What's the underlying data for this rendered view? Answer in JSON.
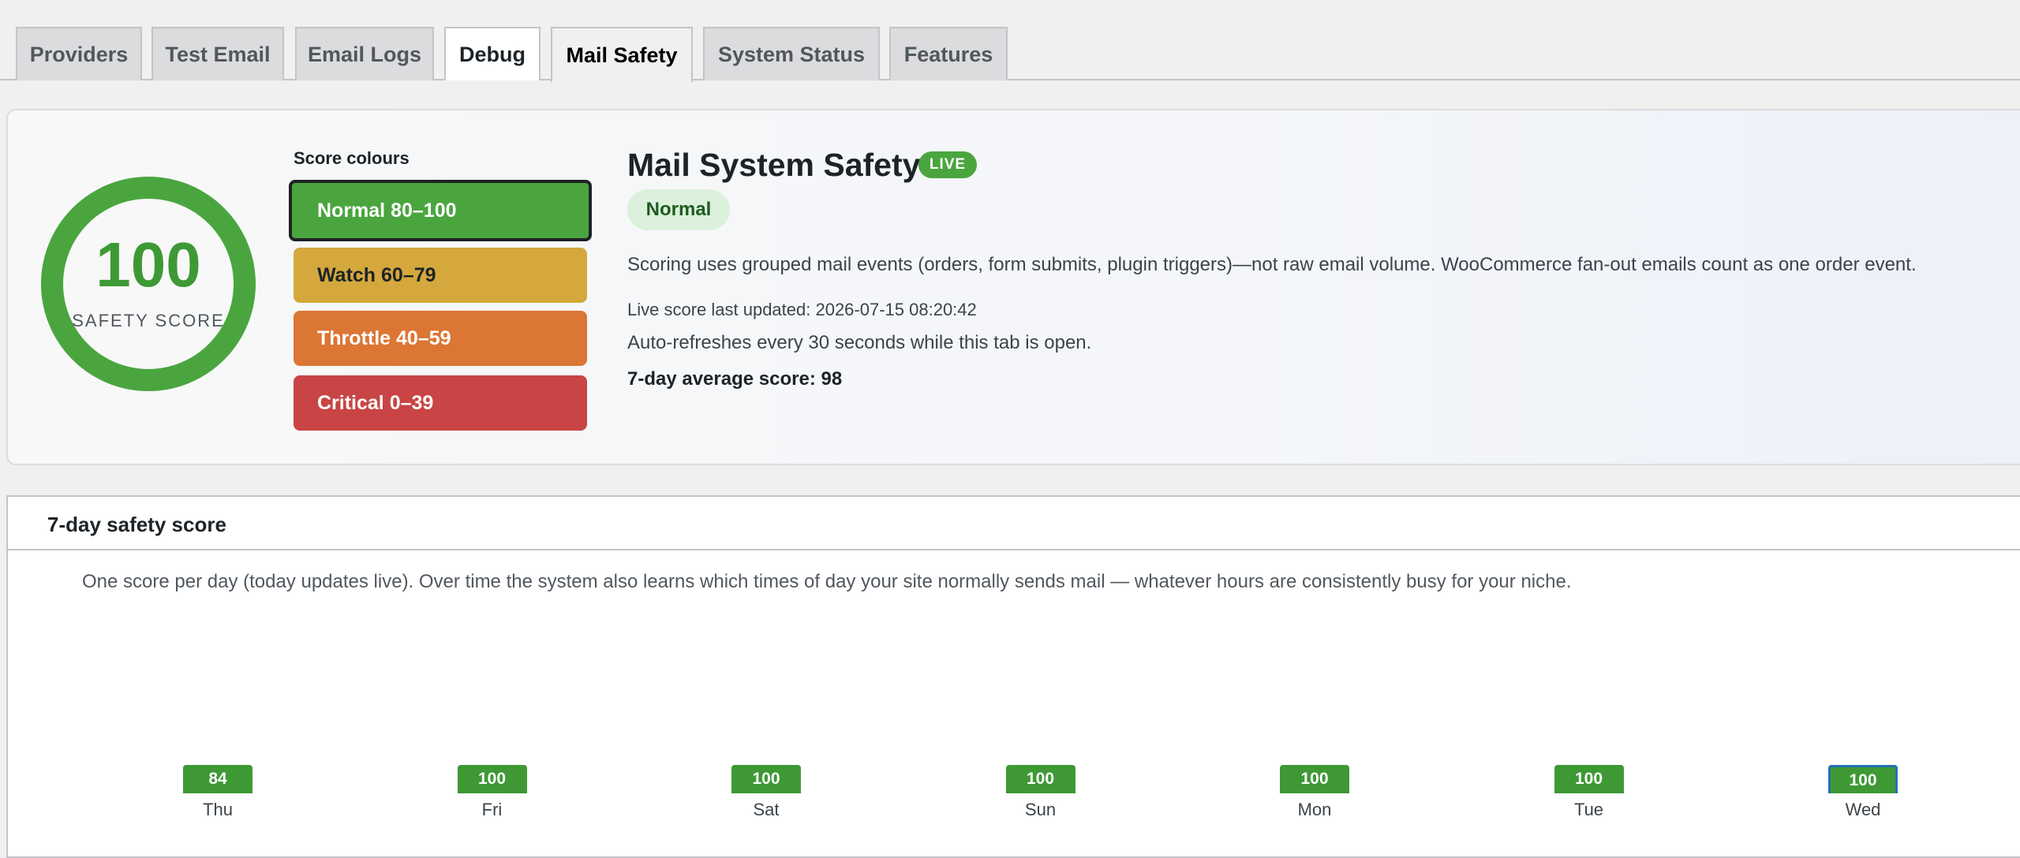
{
  "tabs": [
    {
      "label": "Providers"
    },
    {
      "label": "Test Email"
    },
    {
      "label": "Email Logs"
    },
    {
      "label": "Debug"
    },
    {
      "label": "Mail Safety"
    },
    {
      "label": "System Status"
    },
    {
      "label": "Features"
    }
  ],
  "active_tab": "Mail Safety",
  "gauge": {
    "value": "100",
    "label": "SAFETY SCORE",
    "color": "#4aa53f"
  },
  "legend": {
    "title": "Score colours",
    "items": [
      {
        "label": "Normal 80–100",
        "color": "#4aa53f"
      },
      {
        "label": "Watch 60–79",
        "color": "#d4a83c"
      },
      {
        "label": "Throttle 40–59",
        "color": "#dc7634"
      },
      {
        "label": "Critical 0–39",
        "color": "#c94444"
      }
    ]
  },
  "summary": {
    "title": "Mail System Safety",
    "live_badge": "LIVE",
    "status": "Normal",
    "description": "Scoring uses grouped mail events (orders, form submits, plugin triggers)—not raw email volume. WooCommerce fan-out emails count as one order event.",
    "last_updated": "Live score last updated: 2026-07-15 08:20:42",
    "refresh_note": "Auto-refreshes every 30 seconds while this tab is open.",
    "average": "7-day average score: 98"
  },
  "history": {
    "title": "7-day safety score",
    "description": "One score per day (today updates live). Over time the system also learns which times of day your site normally sends mail — whatever hours are consistently busy for your niche."
  },
  "chart_data": {
    "type": "bar",
    "categories": [
      "Thu",
      "Fri",
      "Sat",
      "Sun",
      "Mon",
      "Tue",
      "Wed"
    ],
    "values": [
      84,
      100,
      100,
      100,
      100,
      100,
      100
    ],
    "value_labels": [
      "84",
      "100",
      "100",
      "100",
      "100",
      "100",
      "100"
    ],
    "highlight": "Wed",
    "bar_color": "#3e9935"
  }
}
